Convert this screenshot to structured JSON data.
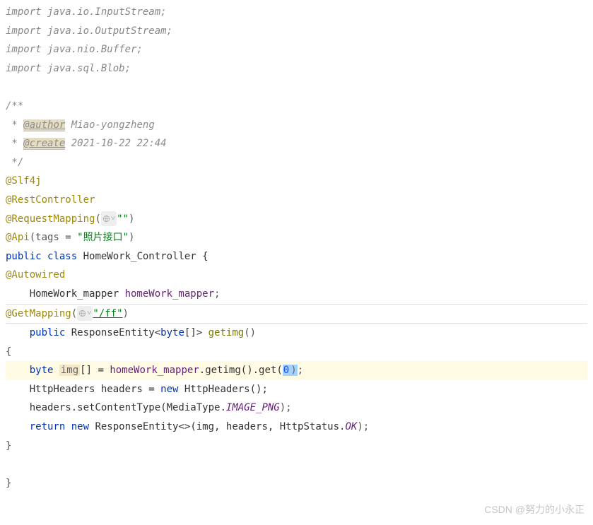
{
  "imports": [
    "import java.io.InputStream;",
    "import java.io.OutputStream;",
    "import java.nio.Buffer;",
    "import java.sql.Blob;"
  ],
  "comment": {
    "open": "/**",
    "author_tag": "@author",
    "author_val": " Miao-yongzheng",
    "create_tag": "@create",
    "create_val": " 2021-10-22 22:44",
    "close": " */"
  },
  "annotations": {
    "slf4j": "@Slf4j",
    "rest": "@RestController",
    "reqmap": "@RequestMapping",
    "reqmap_val": "\"\"",
    "api": "@Api",
    "api_arg": "(tags = ",
    "api_str": "\"照片接口\"",
    "api_close": ")",
    "autowired": "@Autowired",
    "getmap": "@GetMapping",
    "getmap_val": "\"/ff\""
  },
  "class": {
    "public": "public ",
    "class_kw": "class ",
    "name": "HomeWork_Controller {",
    "field_type": "HomeWork_mapper ",
    "field_name": "homeWork_mapper",
    "semi": ";"
  },
  "method": {
    "public": "public ",
    "ret_type": "ResponseEntity<",
    "byte_kw": "byte",
    "arr": "[]> ",
    "name": "getimg",
    "paren": "()",
    "open_brace": "{",
    "body1_byte": "byte ",
    "body1_var": "img",
    "body1_arr": "[] = ",
    "body1_mapper": "homeWork_mapper",
    "body1_call": ".getimg().get(",
    "body1_zero": "0",
    "body1_closeparen": ")",
    "body1_end": ";",
    "body2_a": "HttpHeaders headers = ",
    "body2_new": "new ",
    "body2_b": "HttpHeaders();",
    "body3_a": "headers.setContentType(MediaType.",
    "body3_const": "IMAGE_PNG",
    "body3_end": ");",
    "ret_kw": "return ",
    "ret_new": "new ",
    "ret_a": "ResponseEntity<>(img, headers, HttpStatus.",
    "ret_const": "OK",
    "ret_end": ");",
    "close_brace": "}",
    "class_close": "}"
  },
  "watermark": "CSDN @努力的小永正"
}
